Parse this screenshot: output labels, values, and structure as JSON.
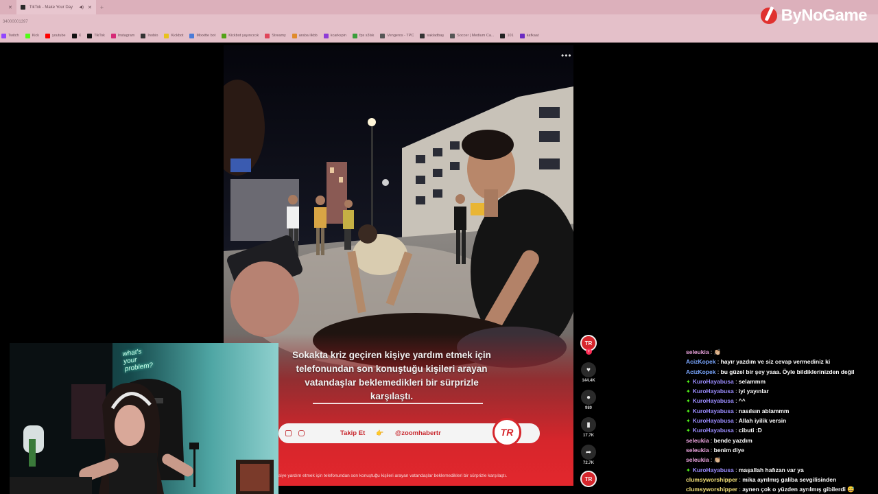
{
  "browser": {
    "tabs": [
      {
        "label": "",
        "close": "✕"
      },
      {
        "label": "TikTok - Make Your Day",
        "close": "✕"
      }
    ],
    "new_tab": "+",
    "address": "34000001397",
    "bookmarks": [
      {
        "label": "Twitch",
        "color": "#9146ff"
      },
      {
        "label": "Kick",
        "color": "#53fc18"
      },
      {
        "label": "youtube",
        "color": "#ff0000"
      },
      {
        "label": "X",
        "color": "#111111"
      },
      {
        "label": "TikTok",
        "color": "#111111"
      },
      {
        "label": "Instagram",
        "color": "#d62976"
      },
      {
        "label": "Inobio",
        "color": "#333333"
      },
      {
        "label": "Kickbot",
        "color": "#e8c21c"
      },
      {
        "label": "Mixxitte bot",
        "color": "#4a7bd8"
      },
      {
        "label": "Kickbot yayıncıcık",
        "color": "#53a318"
      },
      {
        "label": "Streamy",
        "color": "#e0455a"
      },
      {
        "label": "araba ilkbb",
        "color": "#e08a2a"
      },
      {
        "label": "kcarkspin",
        "color": "#8e3bd6"
      },
      {
        "label": "fps s3lsk",
        "color": "#3a9e3a"
      },
      {
        "label": "Vengeros - TPC",
        "color": "#555555"
      },
      {
        "label": "sakladbaş",
        "color": "#333333"
      },
      {
        "label": "Soccer | Medium Ca...",
        "color": "#555555"
      },
      {
        "label": "101",
        "color": "#222222"
      },
      {
        "label": "kafkaat",
        "color": "#6a2ac2"
      }
    ]
  },
  "brand": {
    "name": "ByNoGame",
    "color": "#e0312f"
  },
  "video": {
    "more": "•••",
    "caption": [
      "Sokakta kriz geçiren kişiye yardım etmek için",
      "telefonundan son konuştuğu kişileri arayan",
      "vatandaşlar beklemedikleri bir sürprizle",
      "karşılaştı."
    ],
    "follow_label": "Takip Et",
    "follow_emoji": "👉",
    "handle": "@zoomhabertr",
    "badge": "TR",
    "subtitle": "siye yardım etmek için telefonundan son konuştuğu kişileri arayan vatandaşlar beklemedikleri bir sürprizle karşılaştı."
  },
  "actions": {
    "avatar": "TR",
    "plus": "+",
    "likes": "144.4K",
    "comments": "980",
    "saves": "17.7K",
    "shares": "72.7K"
  },
  "webcam": {
    "neon": [
      "what's",
      "your",
      "problem?"
    ]
  },
  "chat": [
    {
      "user": "seleukia",
      "color": "#eda5e0",
      "badge": "",
      "text": "👏🏼"
    },
    {
      "user": "AcizKopek",
      "color": "#7aa7ff",
      "badge": "",
      "text": "hayır yazdım ve siz cevap vermediniz ki"
    },
    {
      "user": "AcizKopek",
      "color": "#7aa7ff",
      "badge": "",
      "text": "bu güzel bir şey yaaa. Öyle bildiklerinizden değil"
    },
    {
      "user": "KuroHayabusa",
      "color": "#9b8cff",
      "badge": "✦",
      "text": "selammm"
    },
    {
      "user": "KuroHayabusa",
      "color": "#9b8cff",
      "badge": "✦",
      "text": "iyi yayınlar"
    },
    {
      "user": "KuroHayabusa",
      "color": "#9b8cff",
      "badge": "✦",
      "text": "^^"
    },
    {
      "user": "KuroHayabusa",
      "color": "#9b8cff",
      "badge": "✦",
      "text": "nasılsın ablammm"
    },
    {
      "user": "KuroHayabusa",
      "color": "#9b8cff",
      "badge": "✦",
      "text": "Allah iyilik versin"
    },
    {
      "user": "KuroHayabusa",
      "color": "#9b8cff",
      "badge": "✦",
      "text": "cibuti :D"
    },
    {
      "user": "seleukia",
      "color": "#eda5e0",
      "badge": "",
      "text": "bende yazdım"
    },
    {
      "user": "seleukia",
      "color": "#eda5e0",
      "badge": "",
      "text": "benim diye"
    },
    {
      "user": "seleukia",
      "color": "#eda5e0",
      "badge": "",
      "text": "👏🏼"
    },
    {
      "user": "KuroHayabusa",
      "color": "#9b8cff",
      "badge": "✦",
      "text": "maşallah hafızan var ya"
    },
    {
      "user": "clumsyworshipper",
      "color": "#f5e27a",
      "badge": "",
      "text": "mika ayrılmış galiba sevgilisinden"
    },
    {
      "user": "clumsyworshipper",
      "color": "#f5e27a",
      "badge": "",
      "text": "aynen çok o yüzden ayrılmış gibilerdi 😅"
    }
  ]
}
